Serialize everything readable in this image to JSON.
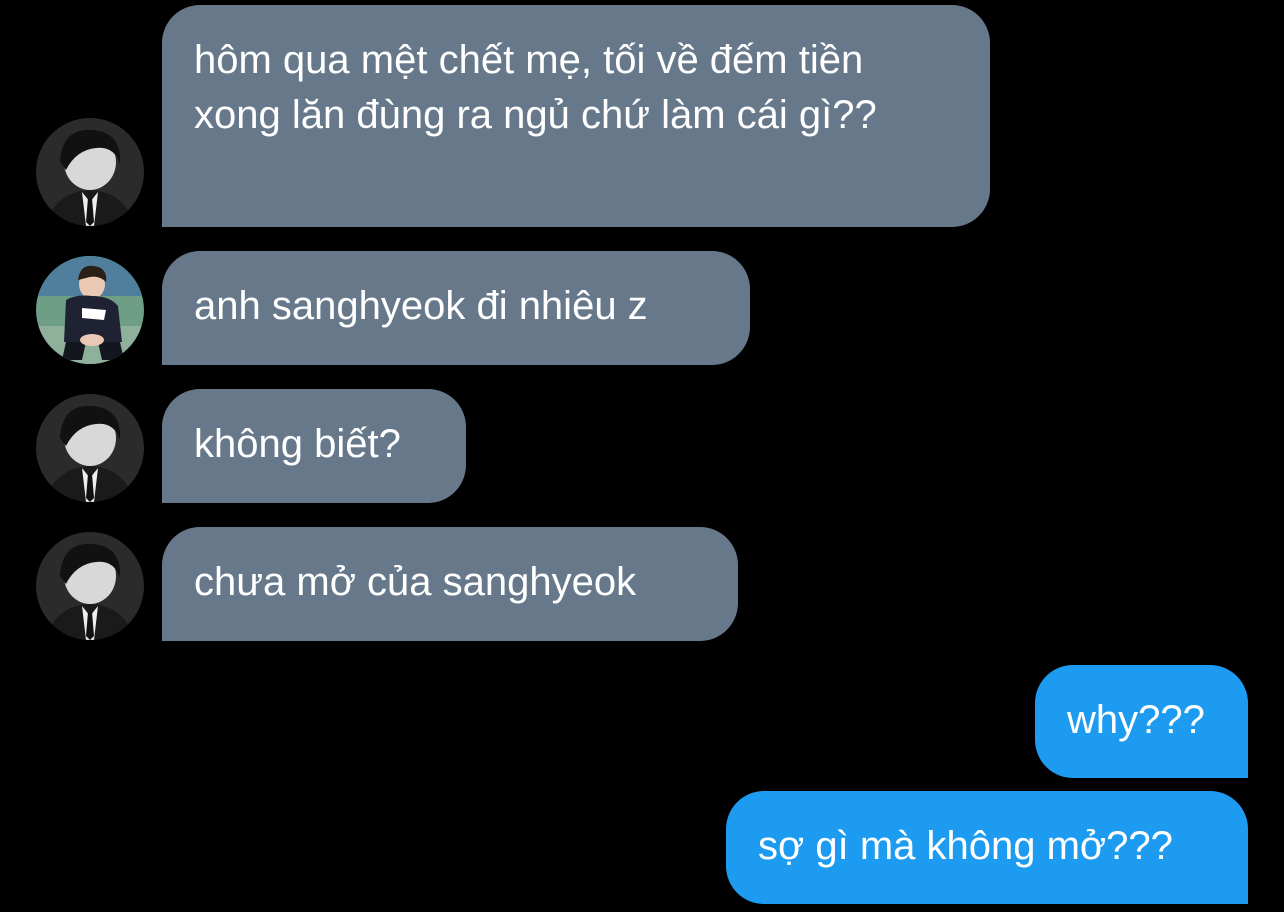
{
  "conversation": {
    "messages": [
      {
        "side": "in",
        "avatar": "grayscale-person-avatar-icon",
        "text": "hôm qua mệt chết mẹ, tối về đếm tiền xong lăn đùng ra ngủ chứ làm cái gì??"
      },
      {
        "side": "in",
        "avatar": "color-person-avatar-icon",
        "text": "anh sanghyeok đi nhiêu z"
      },
      {
        "side": "in",
        "avatar": "grayscale-person-avatar-icon",
        "text": "không biết?"
      },
      {
        "side": "in",
        "avatar": "grayscale-person-avatar-icon",
        "text": "chưa mở của sanghyeok"
      },
      {
        "side": "out",
        "text": "why???"
      },
      {
        "side": "out",
        "text": "sợ gì mà không mở???"
      }
    ]
  },
  "colors": {
    "background": "#000000",
    "incoming_bubble": "#66788a",
    "outgoing_bubble": "#1d9bf0",
    "text": "#ffffff"
  }
}
